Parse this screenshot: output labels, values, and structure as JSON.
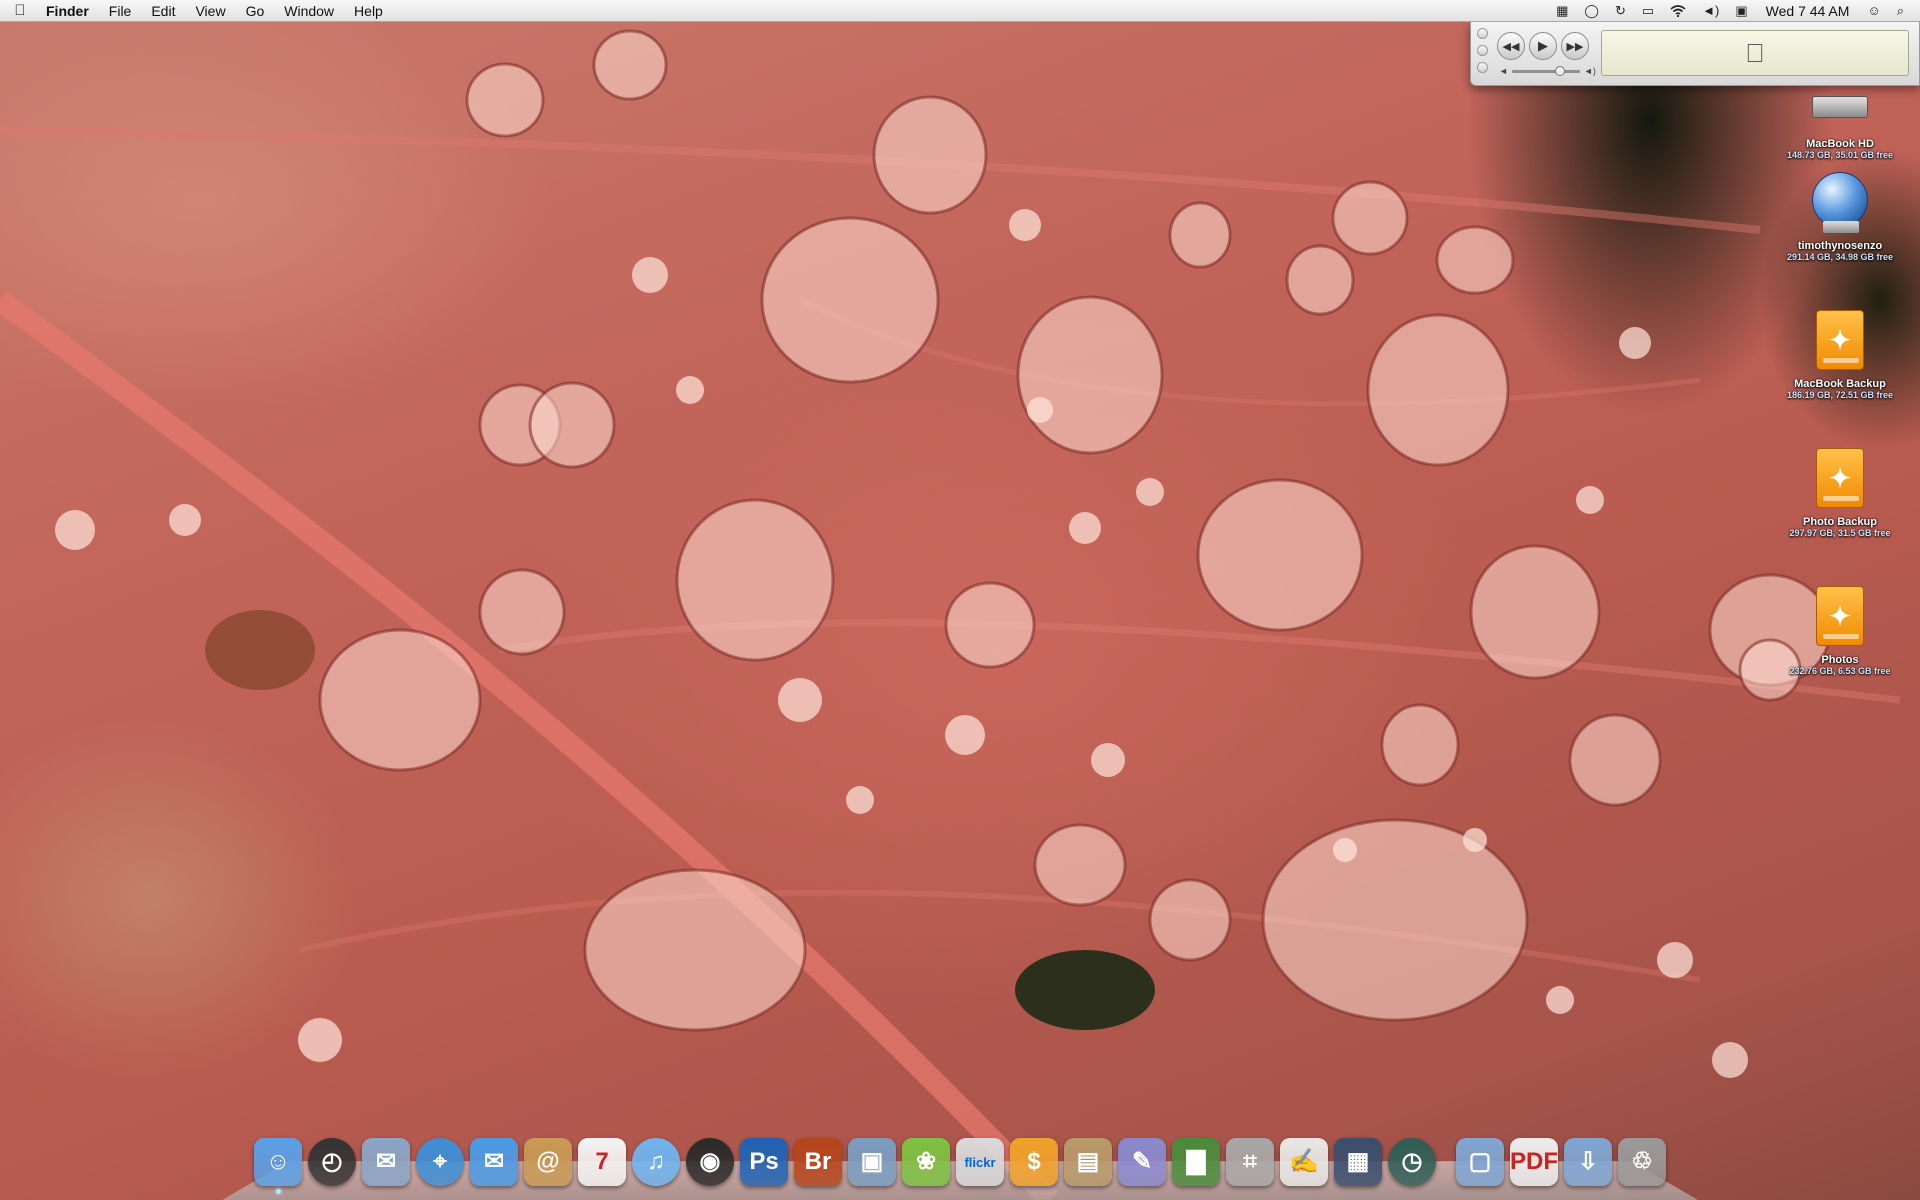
{
  "menubar": {
    "apple_icon": "apple-logo-icon",
    "app_name": "Finder",
    "menus": [
      "File",
      "Edit",
      "View",
      "Go",
      "Window",
      "Help"
    ],
    "clock": "Wed 7 44 AM",
    "extras": [
      "spaces-icon",
      "ichat-status-icon",
      "time-machine-icon",
      "battery-icon",
      "wifi-icon",
      "volume-icon",
      "display-icon"
    ]
  },
  "player": {
    "controls": [
      "rewind",
      "play",
      "fast-forward"
    ],
    "lcd_logo": "apple-logo-icon",
    "volume_level": 0.75
  },
  "desktop_icons": [
    {
      "name": "MacBook HD",
      "info": "148.73 GB, 35.01 GB free",
      "icon": "internal-hard-drive-icon"
    },
    {
      "name": "timothynosenzo",
      "info": "291.14 GB, 34.98 GB free",
      "icon": "network-volume-icon"
    },
    {
      "name": "MacBook Backup",
      "info": "186.19 GB, 72.51 GB free",
      "icon": "firewire-drive-icon"
    },
    {
      "name": "Photo Backup",
      "info": "297.97 GB, 31.5 GB free",
      "icon": "firewire-drive-icon"
    },
    {
      "name": "Photos",
      "info": "232.76 GB, 6.53 GB free",
      "icon": "firewire-drive-icon"
    }
  ],
  "dock": {
    "apps": [
      {
        "name": "finder",
        "label": "",
        "color": "#5aa0e8"
      },
      {
        "name": "dashboard",
        "label": "",
        "color": "#333333"
      },
      {
        "name": "mail",
        "label": "",
        "color": "#8aa6c8"
      },
      {
        "name": "safari",
        "label": "",
        "color": "#3d8fd8"
      },
      {
        "name": "ichat",
        "label": "",
        "color": "#4a9be6"
      },
      {
        "name": "address-book",
        "label": "@",
        "color": "#c89a55"
      },
      {
        "name": "ical",
        "label": "7",
        "color": "#f4f4f4"
      },
      {
        "name": "itunes",
        "label": "",
        "color": "#6fb4f0"
      },
      {
        "name": "aperture",
        "label": "",
        "color": "#2a2a2a"
      },
      {
        "name": "photoshop",
        "label": "Ps",
        "color": "#1f63b5"
      },
      {
        "name": "bridge",
        "label": "Br",
        "color": "#b5451b"
      },
      {
        "name": "iphoto",
        "label": "",
        "color": "#7a9ec2"
      },
      {
        "name": "cyberduck",
        "label": "",
        "color": "#7dc242"
      },
      {
        "name": "flickr-uploadr",
        "label": "flickr",
        "color": "#d9d9d9"
      },
      {
        "name": "money",
        "label": "$",
        "color": "#f0a22a"
      },
      {
        "name": "keynote",
        "label": "",
        "color": "#b89a6a"
      },
      {
        "name": "script-editor",
        "label": "",
        "color": "#8a8ad0"
      },
      {
        "name": "numbers",
        "label": "",
        "color": "#4a8c3c"
      },
      {
        "name": "calculator",
        "label": "",
        "color": "#a8a8a8"
      },
      {
        "name": "textedit",
        "label": "",
        "color": "#e8e8e8"
      },
      {
        "name": "expose",
        "label": "",
        "color": "#3a4e6e"
      },
      {
        "name": "time-machine",
        "label": "",
        "color": "#2f5f55"
      }
    ],
    "stacks": [
      {
        "name": "applications-folder",
        "label": "",
        "color": "#7fa6d4"
      },
      {
        "name": "documents-stack",
        "label": "PDF",
        "color": "#eeeeee"
      },
      {
        "name": "downloads-folder",
        "label": "",
        "color": "#7fa6d4"
      },
      {
        "name": "trash",
        "label": "",
        "color": "#9a9a9a"
      }
    ]
  }
}
